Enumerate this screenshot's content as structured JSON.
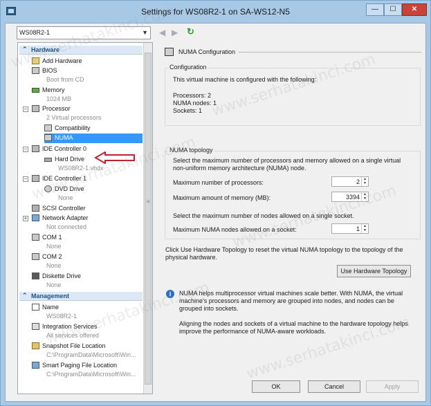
{
  "window": {
    "title": "Settings for WS08R2-1 on SA-WS12-N5",
    "minimize_glyph": "—",
    "maximize_glyph": "☐",
    "close_glyph": "✕"
  },
  "vm_selector": {
    "selected": "WS08R2-1"
  },
  "tree": {
    "hardware_header": "Hardware",
    "add_hardware": "Add Hardware",
    "bios": "BIOS",
    "bios_sub": "Boot from CD",
    "memory": "Memory",
    "memory_sub": "1024 MB",
    "processor": "Processor",
    "processor_sub": "2 Virtual processors",
    "compatibility": "Compatibility",
    "numa": "NUMA",
    "ide0": "IDE Controller 0",
    "hard_drive": "Hard Drive",
    "hard_drive_sub": "WS08R2-1.vhdx",
    "ide1": "IDE Controller 1",
    "dvd_drive": "DVD Drive",
    "dvd_drive_sub": "None",
    "scsi": "SCSI Controller",
    "network": "Network Adapter",
    "network_sub": "Not connected",
    "com1": "COM 1",
    "com1_sub": "None",
    "com2": "COM 2",
    "com2_sub": "None",
    "diskette": "Diskette Drive",
    "diskette_sub": "None",
    "management_header": "Management",
    "name": "Name",
    "name_sub": "WS08R2-1",
    "integration": "Integration Services",
    "integration_sub": "All services offered",
    "snapshot": "Snapshot File Location",
    "snapshot_sub": "C:\\ProgramData\\Microsoft\\Win...",
    "smart_paging": "Smart Paging File Location",
    "smart_paging_sub": "C:\\ProgramData\\Microsoft\\Win..."
  },
  "panel": {
    "heading": "NUMA Configuration",
    "config_group": "Configuration",
    "config_intro": "This virtual machine is configured with the following:",
    "processors_line": "Processors: 2",
    "numa_nodes_line": "NUMA nodes: 1",
    "sockets_line": "Sockets: 1",
    "topology_group": "NUMA topology",
    "topology_desc_1": "Select the maximum number of processors and memory allowed on a single virtual",
    "topology_desc_2": "non-uniform memory architecture (NUMA) node.",
    "max_processors_label": "Maximum number of processors:",
    "max_processors_value": "2",
    "max_memory_label": "Maximum amount of memory (MB):",
    "max_memory_value": "3394",
    "nodes_desc": "Select the maximum number of nodes allowed on a single socket.",
    "max_nodes_label": "Maximum NUMA nodes allowed on a socket:",
    "max_nodes_value": "1",
    "reset_desc_1": "Click Use Hardware Topology to reset the virtual NUMA topology to the topology of the",
    "reset_desc_2": "physical hardware.",
    "use_hw_button": "Use Hardware Topology",
    "info_1": "NUMA helps multiprocessor virtual machines scale better.  With NUMA, the virtual",
    "info_2": "machine's processors and memory are grouped into nodes, and nodes can be",
    "info_3": "grouped into sockets.",
    "info_4": "Aligning the nodes and sockets of a virtual machine to the hardware topology helps",
    "info_5": "improve the performance of NUMA-aware workloads."
  },
  "buttons": {
    "ok": "OK",
    "cancel": "Cancel",
    "apply": "Apply"
  },
  "watermark": "www.serhatakinci.com",
  "colors": {
    "selection": "#3399ff",
    "annotation_arrow": "#c0202a",
    "title_bar": "#a7c9e6"
  }
}
